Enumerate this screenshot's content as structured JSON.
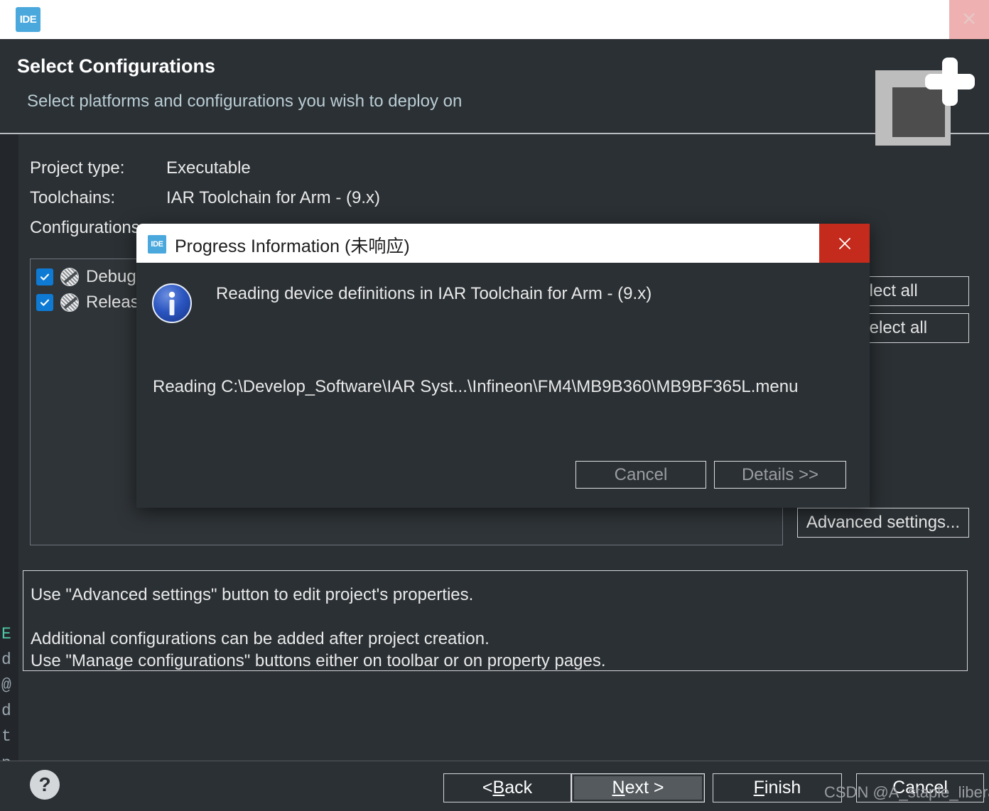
{
  "window": {
    "logo_text": "IDE",
    "logo_name": "ide-logo-icon",
    "close_glyph": "✕"
  },
  "header": {
    "title": "Select Configurations",
    "subtitle": "Select platforms and configurations you wish to deploy on"
  },
  "background_editor": {
    "visible_chars": [
      "E",
      "d",
      "@",
      "d",
      "t",
      "p"
    ]
  },
  "main": {
    "fields": [
      {
        "label": "Project type:",
        "value": "Executable"
      },
      {
        "label": "Toolchains:",
        "value": "IAR Toolchain for Arm - (9.x)"
      },
      {
        "label": "Configurations:",
        "value": ""
      }
    ],
    "configurations": [
      {
        "name": "Debug",
        "checked": true
      },
      {
        "name": "Release",
        "checked": true
      }
    ],
    "select_all_label": "Select all",
    "deselect_all_label": "Deselect all",
    "advanced_settings_label": "Advanced settings...",
    "description_lines": [
      "Use \"Advanced settings\" button to edit project's properties.",
      "",
      "Additional configurations can be added after project creation.",
      "Use \"Manage configurations\" buttons either on toolbar or on property pages."
    ]
  },
  "footer": {
    "help_glyph": "?",
    "back_prefix": "< ",
    "back_accel": "B",
    "back_rest": "ack",
    "next_accel": "N",
    "next_rest": "ext >",
    "finish_accel": "F",
    "finish_rest": "inish",
    "cancel_label": "Cancel"
  },
  "watermark": {
    "text": "CSDN @A_staple_liberal"
  },
  "dialog": {
    "logo_text": "IDE",
    "title": "Progress Information (未响应)",
    "close_glyph": "✕",
    "message": "Reading device definitions in IAR Toolchain for Arm - (9.x)",
    "detail": "Reading C:\\Develop_Software\\IAR Syst...\\Infineon\\FM4\\MB9B360\\MB9BF365L.menu",
    "cancel_label": "Cancel",
    "details_label": "Details >>"
  },
  "colors": {
    "app_background": "#2b3034",
    "titlebar": "#ffffff",
    "accent_blue": "#0f7ad4",
    "logo_blue": "#4aa8dd",
    "dialog_close_red": "#c42b1c",
    "window_close_pink": "#eeb0b0",
    "subtitle_teal": "#b9cdd4",
    "button_border": "#d3d6d9",
    "disabled_text": "#9a9ea2",
    "next_button_fill": "#555a5e"
  }
}
